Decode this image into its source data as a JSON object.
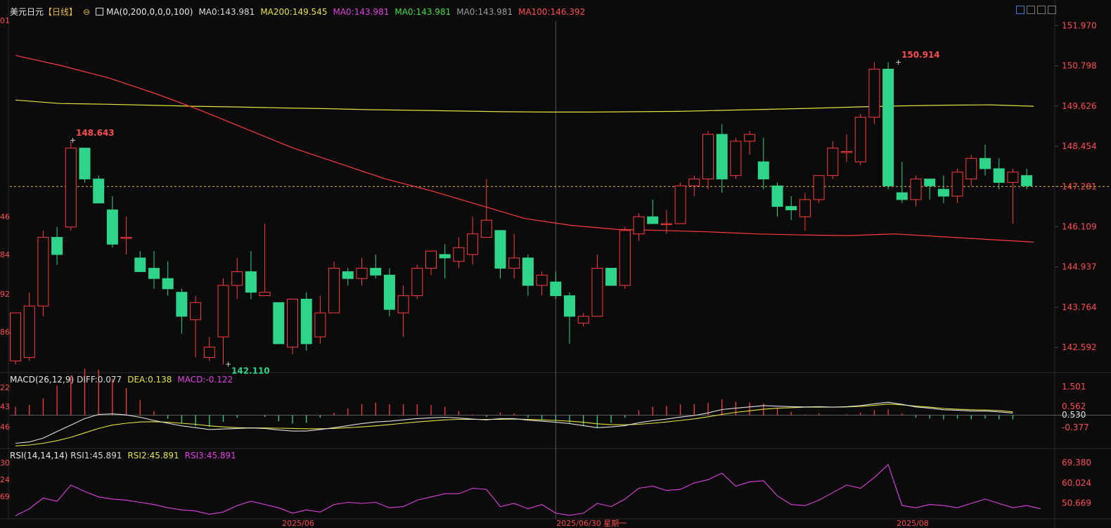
{
  "header": {
    "symbol": "美元日元",
    "period": "【日线】",
    "ma_label": "MA(0,200,0,0,0,100)",
    "ma_items": [
      {
        "text": "MA0:143.981",
        "color": "#d9d9d9"
      },
      {
        "text": "MA200:149.545",
        "color": "#e6e23c"
      },
      {
        "text": "MA0:143.981",
        "color": "#e040e0"
      },
      {
        "text": "MA0:143.981",
        "color": "#3fdc3f"
      },
      {
        "text": "MA0:143.981",
        "color": "#9a9a9a"
      },
      {
        "text": "MA100:146.392",
        "color": "#ff4d4d"
      }
    ],
    "macd_label": "MACD(26,12,9)",
    "macd_items": [
      {
        "text": "DIFF:0.077",
        "color": "#d9d9d9"
      },
      {
        "text": "DEA:0.138",
        "color": "#e6e23c"
      },
      {
        "text": "MACD:-0.122",
        "color": "#e040e0"
      }
    ],
    "rsi_label": "RSI(14,14,14)",
    "rsi_items": [
      {
        "text": "RSI1:45.891",
        "color": "#d9d9d9"
      },
      {
        "text": "RSI2:45.891",
        "color": "#e6e23c"
      },
      {
        "text": "RSI3:45.891",
        "color": "#e040e0"
      }
    ]
  },
  "toolbar": [
    "crosshair-icon",
    "layout-icon",
    "layout-icon-2",
    "expand-icon"
  ],
  "colors": {
    "up": "#ff3b3b",
    "down": "#2ed48a",
    "ma200": "#e6e23c",
    "ma100": "#ff3b3b",
    "grid": "#1a1a1a",
    "axis_text": "#ff4d4d"
  },
  "chart_data": {
    "type": "candlestick",
    "price_ticks": [
      "151.970",
      "150.798",
      "149.626",
      "148.454",
      "147.281",
      "146.109",
      "144.937",
      "143.764",
      "142.592"
    ],
    "price_range": [
      141.9,
      152.1
    ],
    "left_ticks": [
      "01",
      "46",
      "84",
      "92",
      "86",
      "22",
      "43",
      "46"
    ],
    "current_price": 147.281,
    "annotations": [
      {
        "text": "148.643",
        "value": 148.643,
        "type": "high"
      },
      {
        "text": "142.110",
        "value": 142.11,
        "type": "low"
      },
      {
        "text": "150.914",
        "value": 150.914,
        "type": "high"
      }
    ],
    "x_labels": [
      "2025/06",
      "2025/06/30 星期一",
      "2025/08"
    ],
    "crosshair_label": "2025/06/30 星期一",
    "candles": [
      {
        "o": 142.2,
        "h": 143.6,
        "l": 142.1,
        "c": 143.6
      },
      {
        "o": 142.3,
        "h": 144.2,
        "l": 142.2,
        "c": 143.8
      },
      {
        "o": 143.8,
        "h": 146.0,
        "l": 143.5,
        "c": 145.8
      },
      {
        "o": 145.8,
        "h": 146.1,
        "l": 145.0,
        "c": 145.3
      },
      {
        "o": 146.1,
        "h": 148.6,
        "l": 146.0,
        "c": 148.4
      },
      {
        "o": 148.4,
        "h": 148.4,
        "l": 147.4,
        "c": 147.5
      },
      {
        "o": 147.5,
        "h": 147.6,
        "l": 146.8,
        "c": 146.8
      },
      {
        "o": 146.6,
        "h": 147.0,
        "l": 145.5,
        "c": 145.6
      },
      {
        "o": 145.8,
        "h": 146.4,
        "l": 145.3,
        "c": 145.8
      },
      {
        "o": 145.2,
        "h": 145.4,
        "l": 144.8,
        "c": 144.8
      },
      {
        "o": 144.9,
        "h": 145.4,
        "l": 144.3,
        "c": 144.6
      },
      {
        "o": 144.6,
        "h": 145.1,
        "l": 144.1,
        "c": 144.3
      },
      {
        "o": 144.2,
        "h": 144.3,
        "l": 143.0,
        "c": 143.5
      },
      {
        "o": 143.4,
        "h": 144.1,
        "l": 142.3,
        "c": 143.9
      },
      {
        "o": 142.3,
        "h": 142.9,
        "l": 142.2,
        "c": 142.6
      },
      {
        "o": 142.9,
        "h": 144.6,
        "l": 142.1,
        "c": 144.4
      },
      {
        "o": 144.4,
        "h": 145.2,
        "l": 144.0,
        "c": 144.8
      },
      {
        "o": 144.8,
        "h": 145.4,
        "l": 144.0,
        "c": 144.2
      },
      {
        "o": 144.1,
        "h": 146.2,
        "l": 144.1,
        "c": 144.2
      },
      {
        "o": 143.9,
        "h": 143.9,
        "l": 142.7,
        "c": 142.7
      },
      {
        "o": 142.6,
        "h": 144.0,
        "l": 142.4,
        "c": 144.0
      },
      {
        "o": 144.0,
        "h": 144.2,
        "l": 142.5,
        "c": 142.7
      },
      {
        "o": 142.9,
        "h": 144.1,
        "l": 142.7,
        "c": 143.6
      },
      {
        "o": 143.6,
        "h": 145.1,
        "l": 143.6,
        "c": 144.9
      },
      {
        "o": 144.8,
        "h": 144.9,
        "l": 144.4,
        "c": 144.6
      },
      {
        "o": 144.6,
        "h": 145.2,
        "l": 144.4,
        "c": 144.9
      },
      {
        "o": 144.9,
        "h": 145.3,
        "l": 144.6,
        "c": 144.7
      },
      {
        "o": 144.7,
        "h": 144.9,
        "l": 143.5,
        "c": 143.7
      },
      {
        "o": 143.6,
        "h": 144.4,
        "l": 142.9,
        "c": 144.1
      },
      {
        "o": 144.1,
        "h": 145.0,
        "l": 144.0,
        "c": 144.9
      },
      {
        "o": 144.9,
        "h": 145.4,
        "l": 144.7,
        "c": 145.4
      },
      {
        "o": 145.3,
        "h": 145.6,
        "l": 144.6,
        "c": 145.2
      },
      {
        "o": 145.1,
        "h": 145.8,
        "l": 144.9,
        "c": 145.5
      },
      {
        "o": 145.3,
        "h": 146.4,
        "l": 145.0,
        "c": 145.9
      },
      {
        "o": 145.8,
        "h": 147.5,
        "l": 145.8,
        "c": 146.3
      },
      {
        "o": 146.0,
        "h": 146.0,
        "l": 144.6,
        "c": 144.9
      },
      {
        "o": 144.9,
        "h": 145.9,
        "l": 144.6,
        "c": 145.2
      },
      {
        "o": 145.2,
        "h": 145.3,
        "l": 144.1,
        "c": 144.4
      },
      {
        "o": 144.4,
        "h": 144.8,
        "l": 144.1,
        "c": 144.7
      },
      {
        "o": 144.5,
        "h": 144.8,
        "l": 144.0,
        "c": 144.1
      },
      {
        "o": 144.1,
        "h": 144.2,
        "l": 142.7,
        "c": 143.5
      },
      {
        "o": 143.3,
        "h": 143.6,
        "l": 143.2,
        "c": 143.5
      },
      {
        "o": 143.5,
        "h": 145.3,
        "l": 143.5,
        "c": 144.9
      },
      {
        "o": 144.9,
        "h": 144.9,
        "l": 144.4,
        "c": 144.4
      },
      {
        "o": 144.4,
        "h": 146.1,
        "l": 144.3,
        "c": 146.0
      },
      {
        "o": 145.9,
        "h": 146.5,
        "l": 145.7,
        "c": 146.4
      },
      {
        "o": 146.4,
        "h": 146.9,
        "l": 146.2,
        "c": 146.2
      },
      {
        "o": 146.2,
        "h": 146.6,
        "l": 145.9,
        "c": 146.2
      },
      {
        "o": 146.2,
        "h": 147.4,
        "l": 146.2,
        "c": 147.3
      },
      {
        "o": 147.3,
        "h": 147.6,
        "l": 147.0,
        "c": 147.5
      },
      {
        "o": 147.5,
        "h": 148.9,
        "l": 147.2,
        "c": 148.8
      },
      {
        "o": 148.8,
        "h": 149.1,
        "l": 147.1,
        "c": 147.5
      },
      {
        "o": 147.6,
        "h": 148.7,
        "l": 147.5,
        "c": 148.6
      },
      {
        "o": 148.6,
        "h": 148.9,
        "l": 148.2,
        "c": 148.8
      },
      {
        "o": 148.0,
        "h": 148.7,
        "l": 147.2,
        "c": 147.5
      },
      {
        "o": 147.3,
        "h": 147.4,
        "l": 146.4,
        "c": 146.7
      },
      {
        "o": 146.7,
        "h": 147.0,
        "l": 146.3,
        "c": 146.6
      },
      {
        "o": 146.4,
        "h": 147.1,
        "l": 146.0,
        "c": 146.9
      },
      {
        "o": 146.9,
        "h": 147.6,
        "l": 146.8,
        "c": 147.6
      },
      {
        "o": 147.6,
        "h": 148.6,
        "l": 147.5,
        "c": 148.4
      },
      {
        "o": 148.3,
        "h": 148.8,
        "l": 148.0,
        "c": 148.3
      },
      {
        "o": 148.0,
        "h": 149.4,
        "l": 147.9,
        "c": 149.3
      },
      {
        "o": 149.3,
        "h": 150.9,
        "l": 149.1,
        "c": 150.7
      },
      {
        "o": 150.7,
        "h": 150.9,
        "l": 147.2,
        "c": 147.3
      },
      {
        "o": 147.1,
        "h": 148.0,
        "l": 146.8,
        "c": 146.9
      },
      {
        "o": 146.9,
        "h": 147.6,
        "l": 146.7,
        "c": 147.5
      },
      {
        "o": 147.5,
        "h": 147.5,
        "l": 146.9,
        "c": 147.3
      },
      {
        "o": 147.2,
        "h": 147.6,
        "l": 146.8,
        "c": 147.0
      },
      {
        "o": 147.0,
        "h": 147.8,
        "l": 146.8,
        "c": 147.7
      },
      {
        "o": 147.5,
        "h": 148.2,
        "l": 147.3,
        "c": 148.1
      },
      {
        "o": 148.1,
        "h": 148.5,
        "l": 147.6,
        "c": 147.8
      },
      {
        "o": 147.8,
        "h": 148.1,
        "l": 147.2,
        "c": 147.4
      },
      {
        "o": 147.4,
        "h": 147.8,
        "l": 146.2,
        "c": 147.7
      },
      {
        "o": 147.6,
        "h": 147.8,
        "l": 147.2,
        "c": 147.3
      }
    ],
    "ma200": [
      149.8,
      149.7,
      149.68,
      149.65,
      149.62,
      149.6,
      149.57,
      149.55,
      149.52,
      149.5,
      149.48,
      149.46,
      149.45,
      149.45,
      149.46,
      149.47,
      149.5,
      149.53,
      149.56,
      149.6,
      149.63,
      149.65,
      149.66,
      149.62
    ],
    "ma100": [
      151.1,
      150.8,
      150.45,
      150.0,
      149.5,
      148.95,
      148.4,
      147.95,
      147.5,
      147.15,
      146.75,
      146.35,
      146.15,
      146.03,
      146.0,
      145.96,
      145.9,
      145.87,
      145.85,
      145.9,
      145.82,
      145.74,
      145.66
    ],
    "macd": {
      "label_ticks": [
        "1.501",
        "0.562",
        "0.530",
        "-0.377"
      ],
      "range": [
        -0.7,
        1.9
      ],
      "diff": [
        -0.55,
        -0.5,
        -0.35,
        -0.1,
        0.15,
        0.4,
        0.56,
        0.58,
        0.54,
        0.45,
        0.33,
        0.22,
        0.12,
        0.05,
        -0.02,
        0.0,
        0.02,
        0.04,
        0.02,
        -0.04,
        -0.08,
        -0.08,
        -0.02,
        0.05,
        0.13,
        0.21,
        0.27,
        0.3,
        0.35,
        0.4,
        0.43,
        0.45,
        0.42,
        0.38,
        0.35,
        0.4,
        0.4,
        0.34,
        0.3,
        0.26,
        0.21,
        0.13,
        0.05,
        0.08,
        0.13,
        0.24,
        0.32,
        0.38,
        0.46,
        0.52,
        0.62,
        0.75,
        0.8,
        0.85,
        0.9,
        0.88,
        0.86,
        0.85,
        0.86,
        0.84,
        0.86,
        0.9,
        0.97,
        1.03,
        0.95,
        0.85,
        0.8,
        0.74,
        0.72,
        0.69,
        0.69,
        0.66,
        0.61
      ],
      "dea": [
        -0.65,
        -0.62,
        -0.55,
        -0.45,
        -0.32,
        -0.15,
        0.02,
        0.15,
        0.22,
        0.27,
        0.28,
        0.26,
        0.22,
        0.18,
        0.12,
        0.08,
        0.05,
        0.04,
        0.04,
        0.03,
        0.02,
        0.01,
        0.01,
        0.02,
        0.05,
        0.08,
        0.12,
        0.17,
        0.22,
        0.27,
        0.31,
        0.35,
        0.37,
        0.37,
        0.37,
        0.37,
        0.38,
        0.37,
        0.35,
        0.33,
        0.3,
        0.26,
        0.2,
        0.17,
        0.16,
        0.18,
        0.22,
        0.27,
        0.33,
        0.39,
        0.47,
        0.56,
        0.64,
        0.7,
        0.76,
        0.8,
        0.82,
        0.84,
        0.84,
        0.84,
        0.85,
        0.87,
        0.91,
        0.96,
        0.93,
        0.88,
        0.84,
        0.79,
        0.76,
        0.74,
        0.73,
        0.71,
        0.66
      ]
    },
    "rsi": {
      "label_ticks": [
        "69.380",
        "60.024",
        "50.669"
      ],
      "left_ticks": [
        "30",
        "24",
        "69"
      ],
      "range": [
        44.0,
        72.0
      ],
      "values": [
        44.8,
        48.0,
        53.0,
        51.5,
        59.0,
        56.0,
        53.5,
        52.5,
        52.0,
        51.0,
        50.0,
        48.5,
        47.5,
        47.0,
        45.5,
        46.5,
        49.5,
        51.5,
        50.0,
        48.5,
        46.0,
        47.5,
        46.5,
        50.0,
        51.0,
        50.5,
        51.0,
        48.5,
        49.0,
        52.0,
        53.5,
        55.0,
        55.0,
        57.5,
        57.0,
        49.0,
        50.5,
        48.0,
        50.0,
        46.0,
        45.0,
        46.0,
        50.5,
        49.0,
        52.5,
        57.5,
        58.5,
        56.5,
        57.0,
        60.0,
        61.5,
        64.5,
        58.5,
        60.5,
        61.0,
        54.0,
        50.0,
        49.5,
        52.0,
        55.5,
        59.0,
        57.5,
        62.5,
        68.5,
        49.5,
        48.5,
        50.0,
        49.5,
        48.5,
        50.5,
        52.5,
        50.5,
        48.5,
        49.5,
        48.0
      ]
    }
  }
}
